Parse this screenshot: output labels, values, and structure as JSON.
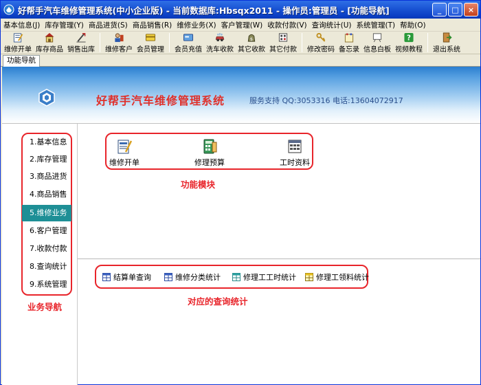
{
  "window": {
    "title": "好帮手汽车维修管理系统(中小企业版) - 当前数据库:Hbsqx2011 - 操作员:管理员 - [功能导航]",
    "controls": {
      "minimize": "_",
      "maximize": "□",
      "close": "×"
    }
  },
  "menu": [
    "基本信息(J)",
    "库存管理(Y)",
    "商品进货(S)",
    "商品销售(R)",
    "维修业务(X)",
    "客户管理(W)",
    "收款付款(V)",
    "查询统计(U)",
    "系统管理(T)",
    "帮助(O)"
  ],
  "toolbar": [
    {
      "label": "维修开单",
      "icon": "repair-order-icon"
    },
    {
      "label": "库存商品",
      "icon": "warehouse-icon"
    },
    {
      "label": "销售出库",
      "icon": "sale-out-icon"
    },
    {
      "label": "维修客户",
      "icon": "repair-customer-icon"
    },
    {
      "label": "会员管理",
      "icon": "member-icon"
    },
    {
      "label": "会员充值",
      "icon": "member-recharge-icon"
    },
    {
      "label": "洗车收款",
      "icon": "carwash-icon"
    },
    {
      "label": "其它收款",
      "icon": "other-income-icon"
    },
    {
      "label": "其它付款",
      "icon": "other-payment-icon"
    },
    {
      "label": "修改密码",
      "icon": "key-icon"
    },
    {
      "label": "备忘录",
      "icon": "memo-icon"
    },
    {
      "label": "信息白板",
      "icon": "whiteboard-icon"
    },
    {
      "label": "视频教程",
      "icon": "help-video-icon"
    },
    {
      "label": "退出系统",
      "icon": "exit-icon"
    }
  ],
  "tab": {
    "label": "功能导航"
  },
  "banner": {
    "title": "好帮手汽车维修管理系统",
    "support": "服务支持  QQ:3053316  电话:13604072917"
  },
  "nav": {
    "items": [
      "1.基本信息",
      "2.库存管理",
      "3.商品进货",
      "4.商品销售",
      "5.维修业务",
      "6.客户管理",
      "7.收款付款",
      "8.查询统计",
      "9.系统管理"
    ],
    "active_index": 4,
    "caption": "业务导航"
  },
  "modules": {
    "items": [
      {
        "label": "维修开单",
        "icon": "repair-order-icon"
      },
      {
        "label": "修理预算",
        "icon": "calculator-icon"
      },
      {
        "label": "工时资料",
        "icon": "labor-data-icon"
      }
    ],
    "caption": "功能模块"
  },
  "queries": {
    "items": [
      {
        "label": "结算单查询",
        "icon": "table-icon"
      },
      {
        "label": "维修分类统计",
        "icon": "table-icon"
      },
      {
        "label": "修理工工时统计",
        "icon": "table-icon"
      },
      {
        "label": "修理工领料统计",
        "icon": "table-icon"
      }
    ],
    "caption": "对应的查询统计"
  },
  "colors": {
    "accent_red": "#e8242a",
    "active_nav": "#1e8f96",
    "titlebar": "#0b3fc4"
  }
}
